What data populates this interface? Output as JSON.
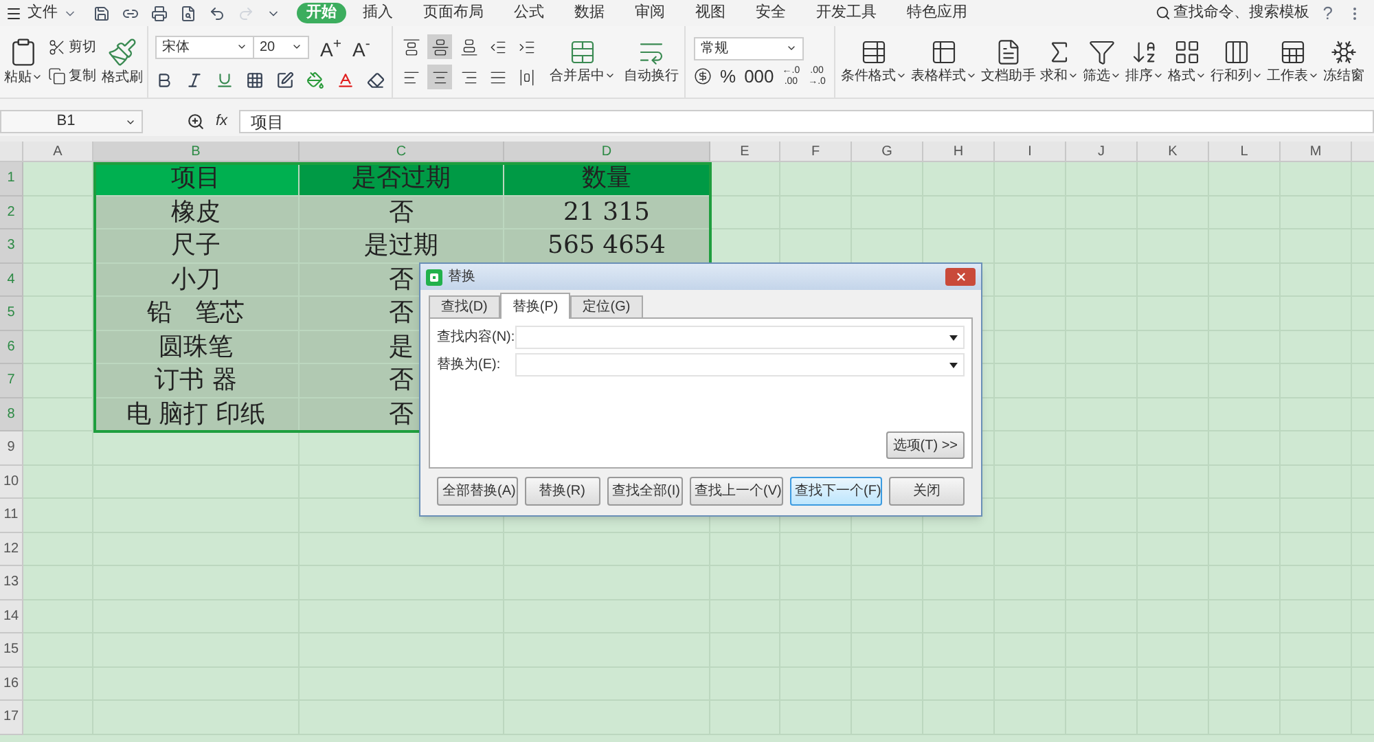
{
  "menu_bar": {
    "file_menu": "文件",
    "tabs": [
      {
        "label": "开始",
        "selected": true
      },
      {
        "label": "插入",
        "selected": false
      },
      {
        "label": "页面布局",
        "selected": false
      },
      {
        "label": "公式",
        "selected": false
      },
      {
        "label": "数据",
        "selected": false
      },
      {
        "label": "审阅",
        "selected": false
      },
      {
        "label": "视图",
        "selected": false
      },
      {
        "label": "安全",
        "selected": false
      },
      {
        "label": "开发工具",
        "selected": false
      },
      {
        "label": "特色应用",
        "selected": false
      }
    ],
    "search": "查找命令、搜索模板",
    "help": "?"
  },
  "ribbon": {
    "clipboard": [
      {
        "kind": "paste",
        "label": "粘贴",
        "dropdown": true
      },
      {
        "kind": "cut",
        "label": "剪切",
        "dropdown": false
      },
      {
        "kind": "copy",
        "label": "复制",
        "dropdown": false
      },
      {
        "kind": "format_painter",
        "label": "格式刷",
        "dropdown": false
      }
    ],
    "font_name": "宋体",
    "font_size": "20",
    "align_buttons": [
      {
        "kind": "top",
        "selected": false
      },
      {
        "kind": "middle",
        "selected": true
      },
      {
        "kind": "bottom",
        "selected": false
      },
      {
        "kind": "outdent",
        "selected": false
      },
      {
        "kind": "indent",
        "selected": false
      },
      {
        "kind": "left",
        "selected": false
      },
      {
        "kind": "center",
        "selected": true
      },
      {
        "kind": "right",
        "selected": false
      },
      {
        "kind": "justify",
        "selected": false
      },
      {
        "kind": "distribute",
        "selected": false
      }
    ],
    "merge": [
      {
        "kind": "merge",
        "label": "合并居中",
        "dropdown": true
      },
      {
        "kind": "wrap",
        "label": "自动换行",
        "dropdown": false
      }
    ],
    "number_format": "常规",
    "font_size_buttons": [
      "A$^{+}$",
      "A$^{-}$"
    ],
    "number_buttons": [
      {
        "kind": "currency"
      },
      {
        "kind": "text",
        "lines": [
          "%"
        ]
      },
      {
        "kind": "text",
        "lines": [
          "000"
        ]
      },
      {
        "kind": "text",
        "lines": [
          "←.0",
          ".00"
        ]
      },
      {
        "kind": "text",
        "lines": [
          ".00",
          "→.0"
        ]
      }
    ],
    "large_buttons": [
      {
        "kind": "conditional",
        "label": "条件格式",
        "dropdown": true
      },
      {
        "kind": "table_style",
        "label": "表格样式",
        "dropdown": true
      },
      {
        "kind": "assistant",
        "label": "文档助手",
        "dropdown": false
      },
      {
        "kind": "sum",
        "label": "求和",
        "dropdown": true
      },
      {
        "kind": "filter",
        "label": "筛选",
        "dropdown": true
      },
      {
        "kind": "sort",
        "label": "排序",
        "dropdown": true
      },
      {
        "kind": "format",
        "label": "格式",
        "dropdown": true
      },
      {
        "kind": "rows_cols",
        "label": "行和列",
        "dropdown": true
      },
      {
        "kind": "sheet",
        "label": "工作表",
        "dropdown": true
      },
      {
        "kind": "freeze",
        "label": "冻结窗",
        "dropdown": false
      }
    ]
  },
  "formula_bar": {
    "name_box": "B1",
    "fx": "fx",
    "value": "项目"
  },
  "sheet": {
    "columns": [
      {
        "label": "A",
        "selected": false
      },
      {
        "label": "B",
        "selected": true
      },
      {
        "label": "C",
        "selected": true
      },
      {
        "label": "D",
        "selected": true
      },
      {
        "label": "E",
        "selected": false
      },
      {
        "label": "F",
        "selected": false
      },
      {
        "label": "G",
        "selected": false
      },
      {
        "label": "H",
        "selected": false
      },
      {
        "label": "I",
        "selected": false
      },
      {
        "label": "J",
        "selected": false
      },
      {
        "label": "K",
        "selected": false
      },
      {
        "label": "L",
        "selected": false
      },
      {
        "label": "M",
        "selected": false
      }
    ],
    "rows": [
      {
        "label": "1",
        "selected": true,
        "kind": "header",
        "cells": [
          "",
          "项目",
          "是否过期",
          "数量"
        ]
      },
      {
        "label": "2",
        "selected": true,
        "kind": "data",
        "cells": [
          "",
          "橡皮",
          "否",
          "21 315"
        ]
      },
      {
        "label": "3",
        "selected": true,
        "kind": "data",
        "cells": [
          "",
          "尺子",
          "是过期",
          "565 4654"
        ]
      },
      {
        "label": "4",
        "selected": true,
        "kind": "data",
        "cells": [
          "",
          "小刀",
          "否"
        ]
      },
      {
        "label": "5",
        "selected": true,
        "kind": "data",
        "cells": [
          "",
          "铅   笔芯",
          "否"
        ]
      },
      {
        "label": "6",
        "selected": true,
        "kind": "data",
        "cells": [
          "",
          "圆珠笔",
          "是"
        ]
      },
      {
        "label": "7",
        "selected": true,
        "kind": "data",
        "cells": [
          "",
          "订书 器",
          "否"
        ]
      },
      {
        "label": "8",
        "selected": true,
        "kind": "data",
        "cells": [
          "",
          "电 脑打 印纸",
          "否"
        ]
      },
      {
        "label": "9",
        "selected": false,
        "kind": "empty",
        "cells": []
      },
      {
        "label": "10",
        "selected": false,
        "kind": "empty",
        "cells": []
      },
      {
        "label": "11",
        "selected": false,
        "kind": "empty",
        "cells": []
      },
      {
        "label": "12",
        "selected": false,
        "kind": "empty",
        "cells": []
      },
      {
        "label": "13",
        "selected": false,
        "kind": "empty",
        "cells": []
      },
      {
        "label": "14",
        "selected": false,
        "kind": "empty",
        "cells": []
      },
      {
        "label": "15",
        "selected": false,
        "kind": "empty",
        "cells": []
      },
      {
        "label": "16",
        "selected": false,
        "kind": "empty",
        "cells": []
      },
      {
        "label": "17",
        "selected": false,
        "kind": "empty",
        "cells": []
      }
    ]
  },
  "dialog": {
    "title": "替换",
    "tabs": [
      {
        "label": "查找(D)",
        "selected": false
      },
      {
        "label": "替换(P)",
        "selected": true
      },
      {
        "label": "定位(G)",
        "selected": false
      }
    ],
    "fields": [
      {
        "label": "查找内容(N):"
      },
      {
        "label": "替换为(E):"
      }
    ],
    "options_button": "选项(T) >>",
    "buttons": [
      {
        "label": "全部替换(A)",
        "default": false
      },
      {
        "label": "替换(R)",
        "default": false
      },
      {
        "label": "查找全部(I)",
        "default": false
      },
      {
        "label": "查找上一个(V)",
        "default": false
      },
      {
        "label": "查找下一个(F)",
        "default": true
      },
      {
        "label": "关闭",
        "default": false
      }
    ]
  }
}
